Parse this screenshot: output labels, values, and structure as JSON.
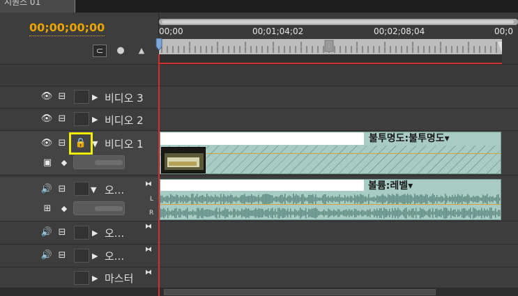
{
  "tab": {
    "title": "시퀀스 01"
  },
  "header": {
    "timecode": "00;00;00;00",
    "snap_icon": "snap-icon",
    "marker_icon": "marker-icon",
    "keyframe_icon": "keyframe-icon"
  },
  "ruler": {
    "labels": [
      "00;00",
      "00;01;04;02",
      "00;02;08;04",
      "00;0"
    ]
  },
  "tracks": {
    "video3": {
      "name": "비디오 3"
    },
    "video2": {
      "name": "비디오 2"
    },
    "video1": {
      "name": "비디오 1"
    },
    "audio1": {
      "name": "오..."
    },
    "audio2": {
      "name": "오..."
    },
    "audio3": {
      "name": "오..."
    },
    "master": {
      "name": "마스터"
    }
  },
  "clips": {
    "video": {
      "effect_label": "불투명도:불투명도▾"
    },
    "audio": {
      "effect_label": "볼륨:레벨▾",
      "left_channel": "L",
      "right_channel": "R"
    }
  },
  "colors": {
    "timecode": "#e8a400",
    "playhead": "#d03030",
    "clip": "#a8ccc4",
    "highlight": "#f3ee00"
  }
}
